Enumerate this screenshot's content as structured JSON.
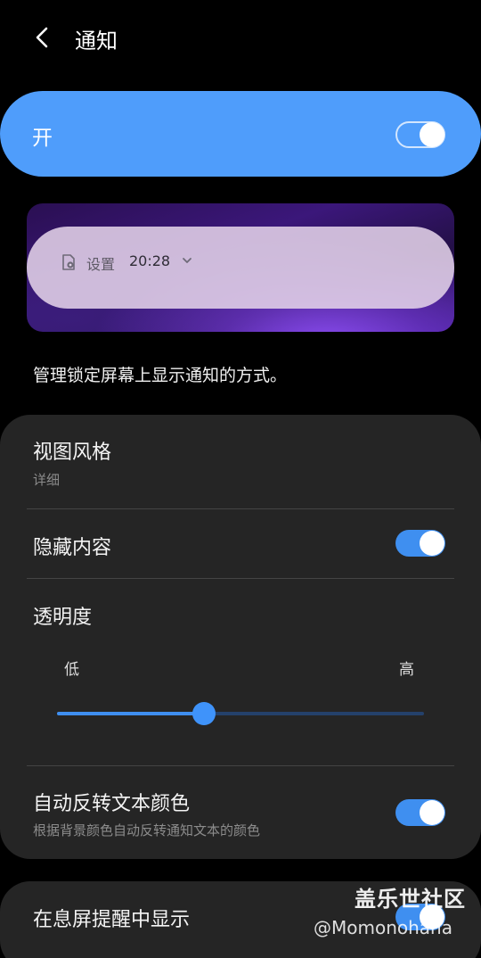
{
  "header": {
    "title": "通知"
  },
  "master": {
    "label": "开",
    "enabled": true
  },
  "preview": {
    "app_name": "设置",
    "time": "20:28"
  },
  "description": "管理锁定屏幕上显示通知的方式。",
  "settings": {
    "view_style": {
      "title": "视图风格",
      "value": "详细"
    },
    "hide_content": {
      "title": "隐藏内容",
      "enabled": true
    },
    "transparency": {
      "title": "透明度",
      "low_label": "低",
      "high_label": "高",
      "level": 0.4
    },
    "auto_reverse": {
      "title": "自动反转文本颜色",
      "subtitle": "根据背景颜色自动反转通知文本的颜色",
      "enabled": true
    }
  },
  "aod": {
    "title": "在息屏提醒中显示",
    "enabled": true
  },
  "watermark": {
    "brand": "盖乐世社区",
    "user": "@Momonohana"
  },
  "colors": {
    "accent": "#4f9dfb",
    "switch_on": "#3f8ff0",
    "card_bg": "#252525",
    "background": "#000000"
  }
}
